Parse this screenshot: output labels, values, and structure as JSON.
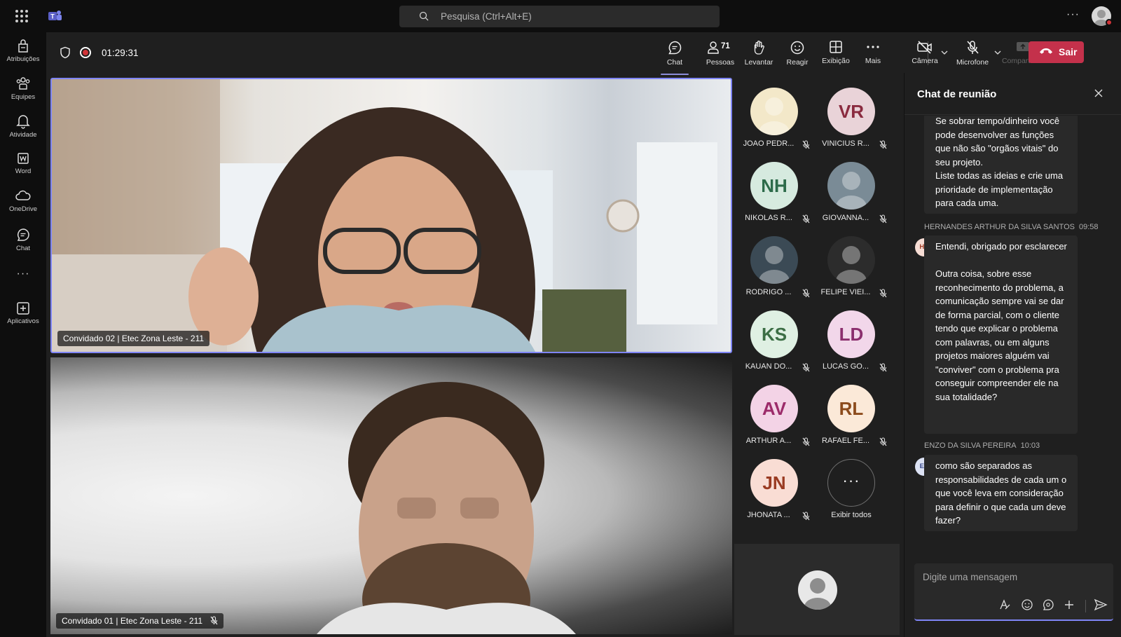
{
  "titlebar": {
    "search_placeholder": "Pesquisa (Ctrl+Alt+E)",
    "more": "···"
  },
  "rail": {
    "items": [
      {
        "label": "Atribuições",
        "icon": "assignments-icon"
      },
      {
        "label": "Equipes",
        "icon": "teams-icon"
      },
      {
        "label": "Atividade",
        "icon": "bell-icon"
      },
      {
        "label": "Word",
        "icon": "word-icon"
      },
      {
        "label": "OneDrive",
        "icon": "cloud-icon"
      },
      {
        "label": "Chat",
        "icon": "chat-icon"
      }
    ],
    "more": "···",
    "apps_label": "Aplicativos"
  },
  "meeting": {
    "timer": "01:29:31",
    "controls": {
      "chat": "Chat",
      "people": "Pessoas",
      "people_count": "71",
      "raise": "Levantar",
      "react": "Reagir",
      "view": "Exibição",
      "more": "Mais",
      "camera": "Câmera",
      "mic": "Microfone",
      "share": "Compartilhar",
      "leave": "Sair"
    },
    "accent_color": "#7f85f5",
    "leave_color": "#c4314b"
  },
  "videos": [
    {
      "name": "Convidado 02 | Etec Zona Leste - 211"
    },
    {
      "name": "Convidado 01 | Etec Zona Leste - 211"
    }
  ],
  "gallery": {
    "participants": [
      {
        "initials": "",
        "name": "JOAO PEDR...",
        "bg": "#f3e8c9",
        "fg": "#333"
      },
      {
        "initials": "VR",
        "name": "VINICIUS R...",
        "bg": "#e9d3d8",
        "fg": "#8a2b3f"
      },
      {
        "initials": "NH",
        "name": "NIKOLAS R...",
        "bg": "#d6eadf",
        "fg": "#2d6b4a"
      },
      {
        "initials": "",
        "name": "GIOVANNA...",
        "bg": "#7a8b96",
        "fg": "#fff"
      },
      {
        "initials": "",
        "name": "RODRIGO ...",
        "bg": "#3b4a55",
        "fg": "#fff"
      },
      {
        "initials": "",
        "name": "FELIPE VIEI...",
        "bg": "#2c2c2c",
        "fg": "#fff"
      },
      {
        "initials": "KS",
        "name": "KAUAN DO...",
        "bg": "#dff0e3",
        "fg": "#3c6e45"
      },
      {
        "initials": "LD",
        "name": "LUCAS GO...",
        "bg": "#f2d7ea",
        "fg": "#8b2f6e"
      },
      {
        "initials": "AV",
        "name": "ARTHUR A...",
        "bg": "#f3d3e6",
        "fg": "#9c2b6a"
      },
      {
        "initials": "RL",
        "name": "RAFAEL FE...",
        "bg": "#fbe9d8",
        "fg": "#8c4b1c"
      },
      {
        "initials": "JN",
        "name": "JHONATA ...",
        "bg": "#f9ddd4",
        "fg": "#9a3b22"
      }
    ],
    "see_all": "Exibir todos"
  },
  "chat": {
    "title": "Chat de reunião",
    "messages": [
      {
        "author": "",
        "time": "",
        "initials": "",
        "text": "Se sobrar tempo/dinheiro você pode desenvolver as funções que não são \"orgãos vitais\" do seu projeto.\nListe todas as ideias e crie uma prioridade de implementação para cada uma."
      },
      {
        "author": "HERNANDES ARTHUR DA SILVA SANTOS",
        "time": "09:58",
        "initials": "HS",
        "avatar_bg": "#f6dcd4",
        "avatar_fg": "#a0402a",
        "text": "Entendi, obrigado por esclarecer\n\nOutra coisa, sobre esse reconhecimento do problema, a comunicação sempre vai se dar de forma parcial, com o cliente tendo que explicar o problema com palavras, ou em alguns projetos maiores alguém vai \"conviver\" com o problema pra conseguir compreender ele na sua totalidade?"
      },
      {
        "author": "ENZO DA SILVA PEREIRA",
        "time": "10:03",
        "initials": "EP",
        "avatar_bg": "#dce2f4",
        "avatar_fg": "#3a4a8c",
        "text": "como são separados as responsabilidades de cada um o que você leva em consideração para definir o que cada um deve fazer?"
      }
    ],
    "composer_placeholder": "Digite uma mensagem"
  }
}
